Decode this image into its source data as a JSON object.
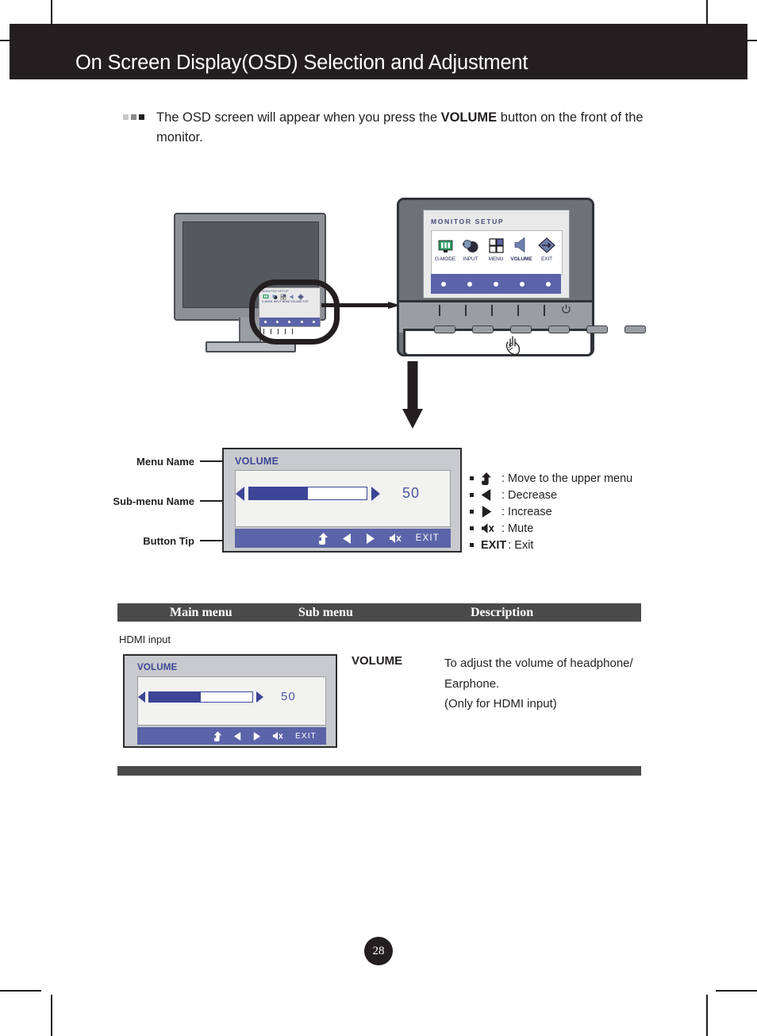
{
  "header": {
    "title": "On Screen Display(OSD) Selection and Adjustment"
  },
  "intro": {
    "text_before": "The OSD screen will appear when you press the ",
    "emphasis": "VOLUME",
    "text_after": " button on the front of the monitor.",
    "bullets": [
      "light-square",
      "mid-square",
      "dark-square"
    ]
  },
  "monitor_diagram": {
    "osd_title": "MONITOR SETUP",
    "osd_items": [
      {
        "label": "G-MODE",
        "icon": "gmode-icon"
      },
      {
        "label": "INPUT",
        "icon": "input-plug-icon"
      },
      {
        "label": "MENU",
        "icon": "menu-grid-icon"
      },
      {
        "label": "VOLUME",
        "icon": "speaker-icon"
      },
      {
        "label": "EXIT",
        "icon": "exit-diamond-icon"
      }
    ],
    "dot_count": 5,
    "button_count": 6,
    "power_icon": "power-icon",
    "hand_icon": "pointing-hand-icon"
  },
  "callout_labels": {
    "menu_name": "Menu Name",
    "sub_menu_name": "Sub-menu Name",
    "button_tip": "Button Tip"
  },
  "osd_big": {
    "title": "VOLUME",
    "value": "50",
    "fill_percent": 50,
    "left_arrow_icon": "triangle-left-icon",
    "right_arrow_icon": "triangle-right-icon",
    "tips": [
      {
        "icon": "up-arrow-icon",
        "label": ""
      },
      {
        "icon": "triangle-left-icon",
        "label": ""
      },
      {
        "icon": "triangle-right-icon",
        "label": ""
      },
      {
        "icon": "mute-icon",
        "label": ""
      }
    ],
    "exit_label": "EXIT"
  },
  "legend": [
    {
      "icon": "up-arrow-icon",
      "text": ": Move to the upper menu"
    },
    {
      "icon": "triangle-left-icon",
      "text": ": Decrease"
    },
    {
      "icon": "triangle-right-icon",
      "text": ": Increase"
    },
    {
      "icon": "mute-icon",
      "text": ": Mute"
    },
    {
      "icon": "",
      "bold_label": "EXIT",
      "text": ": Exit"
    }
  ],
  "table": {
    "headers": {
      "main_menu": "Main menu",
      "sub_menu": "Sub menu",
      "description": "Description"
    },
    "hdmi_note": "HDMI input",
    "row": {
      "sub_menu": "VOLUME",
      "description_line1": "To adjust the volume of headphone/",
      "description_line2": "Earphone.",
      "description_line3": "(Only for HDMI input)"
    }
  },
  "osd_small": {
    "title": "VOLUME",
    "value": "50",
    "fill_percent": 50,
    "exit_label": "EXIT"
  },
  "page": {
    "number": "28"
  },
  "colors": {
    "header_bg": "#231f20",
    "osd_accent": "#3c4596",
    "osd_tipbar": "#5b64a8",
    "table_header_bg": "#4a4a4a"
  }
}
